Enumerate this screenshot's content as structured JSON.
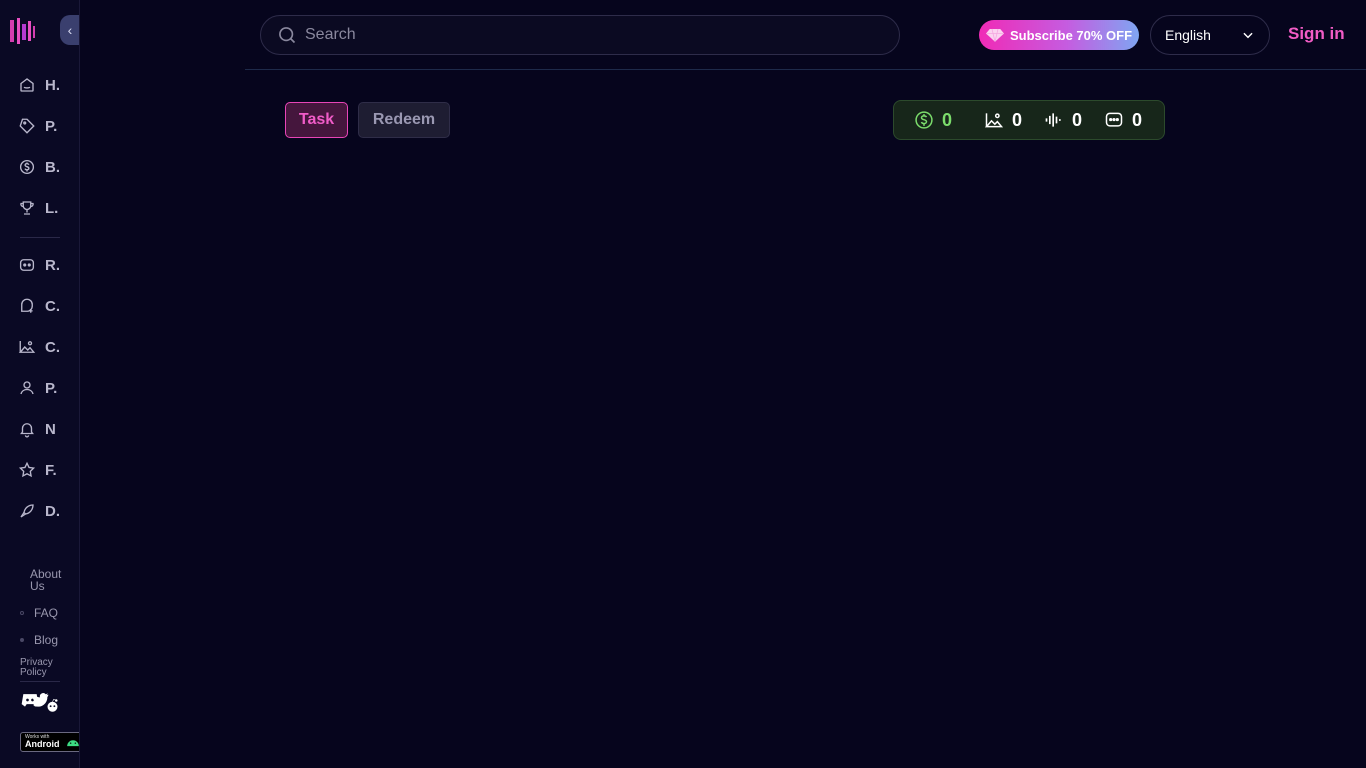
{
  "sidebar": {
    "collapse_glyph": "‹",
    "items": [
      {
        "label": "H.",
        "icon": "home-icon"
      },
      {
        "label": "P.",
        "icon": "tag-icon"
      },
      {
        "label": "B.",
        "icon": "coin-icon"
      },
      {
        "label": "L.",
        "icon": "trophy-icon"
      },
      {
        "label": "R.",
        "icon": "robot-icon"
      },
      {
        "label": "C.",
        "icon": "chat-plus-icon"
      },
      {
        "label": "C.",
        "icon": "image-icon"
      },
      {
        "label": "P.",
        "icon": "user-icon"
      },
      {
        "label": "N",
        "icon": "bell-icon"
      },
      {
        "label": "F.",
        "icon": "star-icon"
      },
      {
        "label": "D.",
        "icon": "rocket-icon"
      }
    ],
    "footer": {
      "about": "About Us",
      "faq": "FAQ",
      "blog": "Blog",
      "privacy": "Privacy Policy"
    },
    "android": {
      "small": "Works with",
      "big": "Android"
    }
  },
  "header": {
    "search_placeholder": "Search",
    "subscribe_label": "Subscribe 70% OFF",
    "language": "English",
    "signin_label": "Sign in"
  },
  "tabs": [
    {
      "label": "Task",
      "active": true
    },
    {
      "label": "Redeem",
      "active": false
    }
  ],
  "stats": [
    {
      "icon": "dollar-coin-icon",
      "value": "0",
      "color": "#7bdc6b"
    },
    {
      "icon": "image-icon",
      "value": "0",
      "color": "#ffffff"
    },
    {
      "icon": "audio-wave-icon",
      "value": "0",
      "color": "#ffffff"
    },
    {
      "icon": "chat-icon",
      "value": "0",
      "color": "#ffffff"
    }
  ],
  "colors": {
    "background": "#06051d",
    "accent_pink": "#f05cc8",
    "accent_green": "#7bdc6b"
  }
}
